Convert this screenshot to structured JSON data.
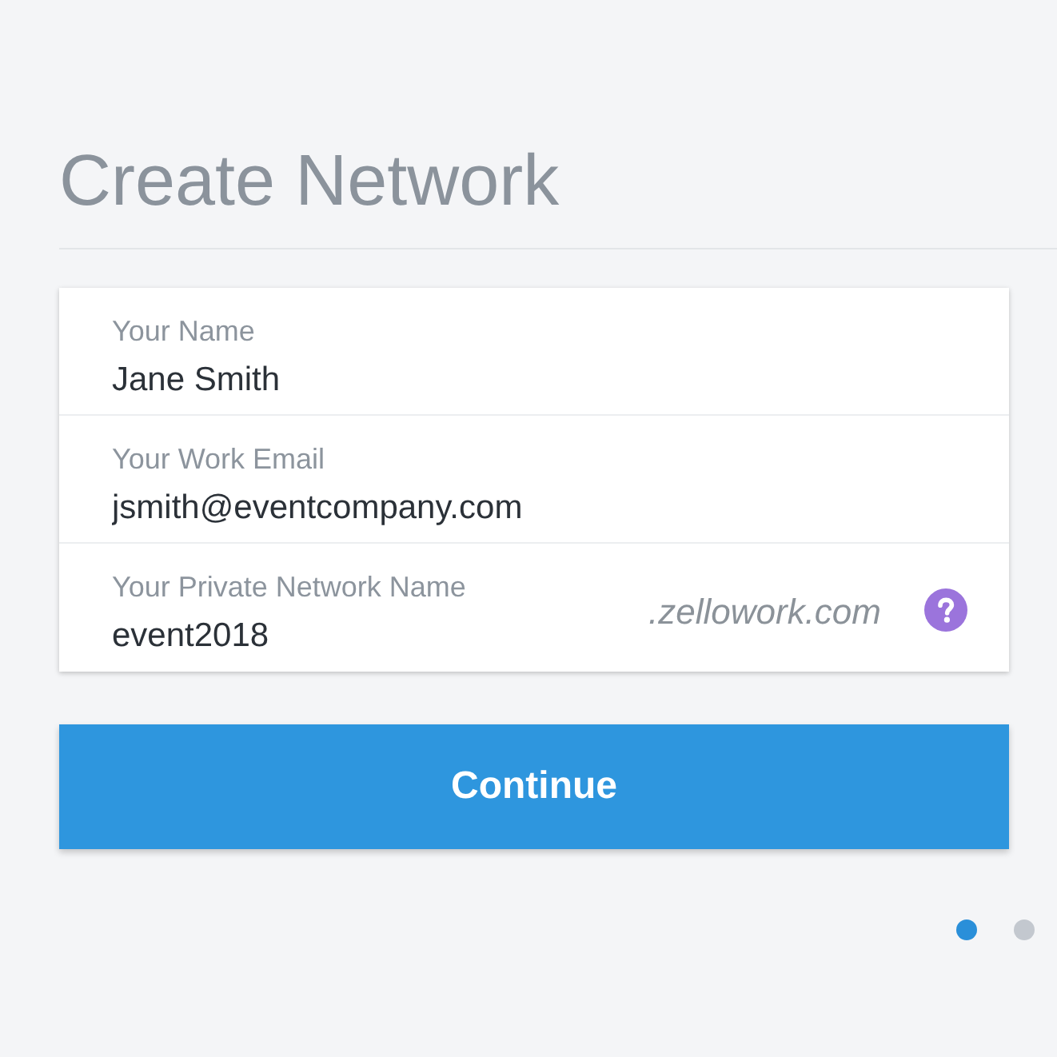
{
  "title": "Create Network",
  "form": {
    "fields": [
      {
        "label": "Your Name",
        "value": "Jane Smith"
      },
      {
        "label": "Your Work Email",
        "value": "jsmith@eventcompany.com"
      },
      {
        "label": "Your Private Network Name",
        "value": "event2018",
        "suffix": ".zellowork.com",
        "help": true
      }
    ]
  },
  "continue_button": {
    "label": "Continue"
  },
  "pager": [
    {
      "selected": true
    },
    {
      "selected": false
    }
  ]
}
